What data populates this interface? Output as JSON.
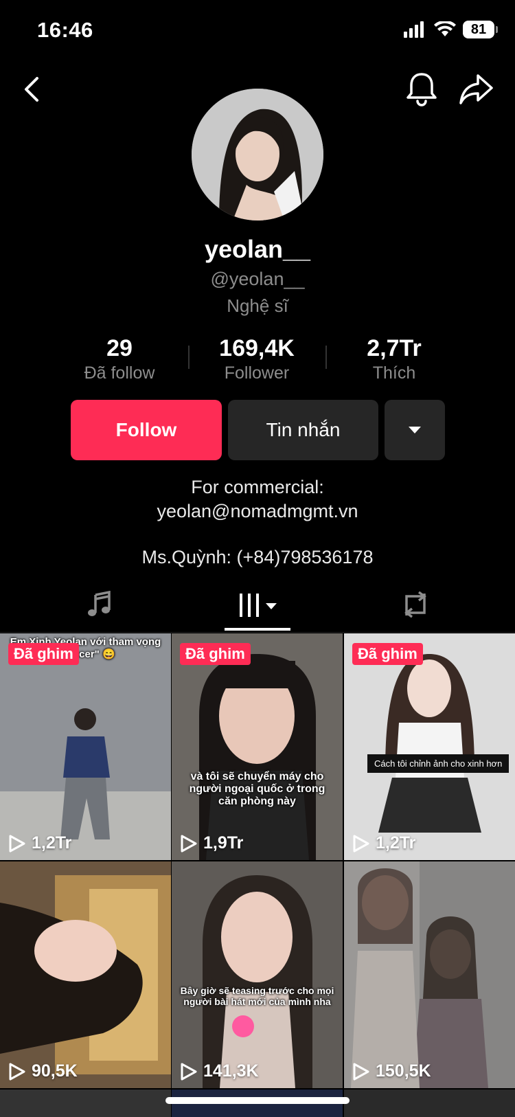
{
  "status": {
    "time": "16:46",
    "battery": "81"
  },
  "profile": {
    "username": "yeolan__",
    "handle": "@yeolan__",
    "category": "Nghệ sĩ"
  },
  "stats": [
    {
      "value": "29",
      "label": "Đã follow"
    },
    {
      "value": "169,4K",
      "label": "Follower"
    },
    {
      "value": "2,7Tr",
      "label": "Thích"
    }
  ],
  "actions": {
    "follow": "Follow",
    "message": "Tin nhắn"
  },
  "bio": {
    "line1": "For commercial:",
    "line2": "yeolan@nomadmgmt.vn",
    "line3": "Ms.Quỳnh: (+84)798536178"
  },
  "tabs": [
    "music-icon",
    "videos-grid-icon",
    "repost-icon"
  ],
  "videos": [
    {
      "pinned": "Đã ghim",
      "views": "1,2Tr",
      "caption": "Em Xinh Yeolan với tham vọng \"dancer\" 😄",
      "bg": "#8d9096"
    },
    {
      "pinned": "Đã ghim",
      "views": "1,9Tr",
      "caption": "và tôi sẽ chuyển máy cho người ngoại quốc ở trong căn phòng này",
      "bg": "#6f6a65"
    },
    {
      "pinned": "Đã ghim",
      "views": "1,2Tr",
      "caption": "Cách tôi chỉnh ảnh cho xinh hơn",
      "bg": "#d9d9d9"
    },
    {
      "views": "90,5K",
      "bg": "#5a4a3c"
    },
    {
      "views": "141,3K",
      "caption": "Bây giờ sẽ teasing trước cho mọi người bài hát mới của mình nha",
      "bg": "#6a655f"
    },
    {
      "views": "150,5K",
      "bg": "#8d8a88"
    }
  ],
  "colors": {
    "accent": "#fe2c55",
    "button_dark": "#262626",
    "muted_text": "#8d8d8d"
  }
}
